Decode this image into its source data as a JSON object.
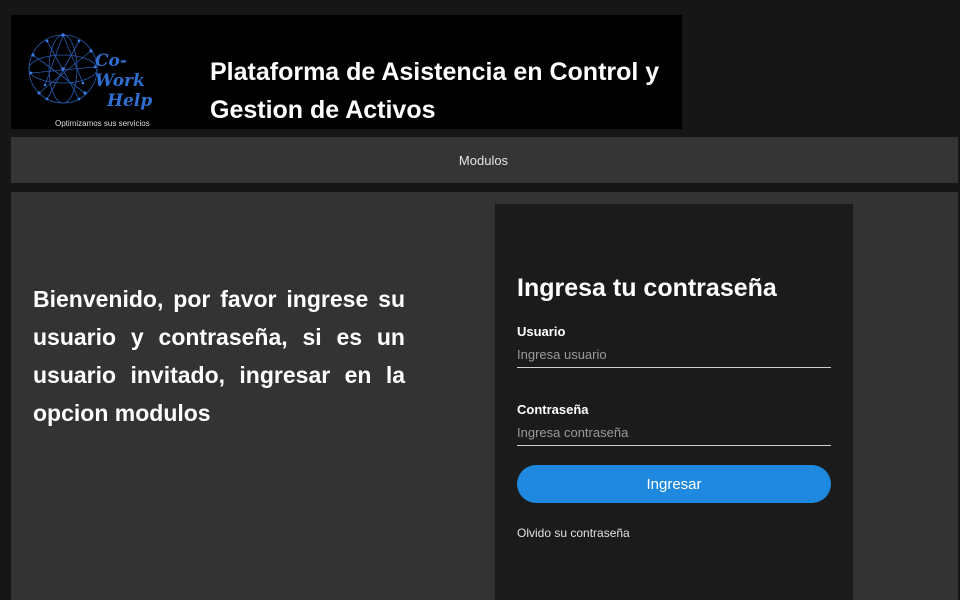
{
  "header": {
    "logo_line1": "Co-Work",
    "logo_line2": "Help",
    "logo_slogan": "Optimizamos sus servicios",
    "title": "Plataforma de Asistencia en Control y Gestion de Activos"
  },
  "nav": {
    "modulos_label": "Modulos"
  },
  "main": {
    "welcome_text": "Bienvenido, por favor ingrese su usuario y contraseña, si es un usuario invitado, ingresar en la opcion modulos"
  },
  "login": {
    "title": "Ingresa tu contraseña",
    "user_label": "Usuario",
    "user_placeholder": "Ingresa usuario",
    "password_label": "Contraseña",
    "password_placeholder": "Ingresa contraseña",
    "submit_label": "Ingresar",
    "forgot_label": "Olvido su contraseña"
  },
  "colors": {
    "page_bg": "#161617",
    "header_bg": "#000000",
    "nav_bg": "#353535",
    "main_bg": "#333333",
    "card_bg": "#1b1b1b",
    "accent": "#1f88df",
    "logo_blue": "#2f6fd0"
  },
  "icons": {
    "logo": "network-globe-icon"
  }
}
